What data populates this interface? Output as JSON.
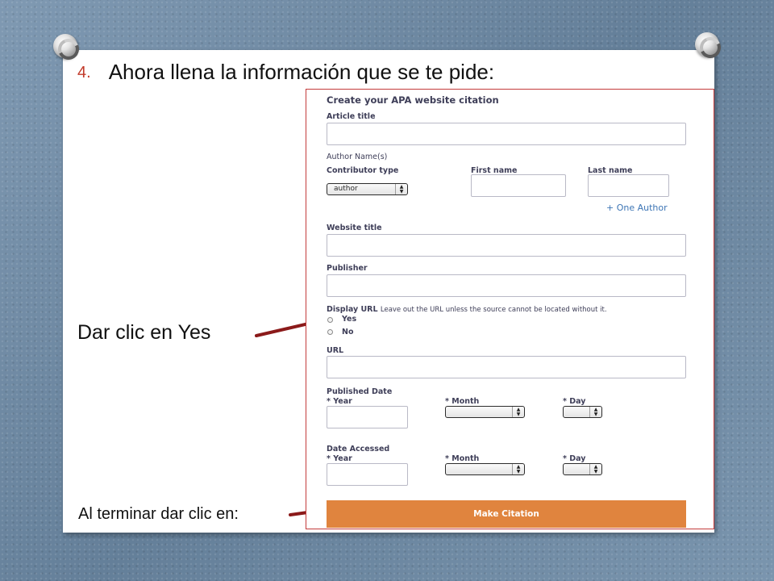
{
  "slide": {
    "step_number": "4.",
    "heading": "Ahora llena la información que se te pide:",
    "callout_yes": "Dar clic en Yes",
    "callout_finish": "Al terminar dar clic en:"
  },
  "form": {
    "title": "Create your APA website citation",
    "article_title_label": "Article title",
    "author_names_label": "Author Name(s)",
    "contributor_type_label": "Contributor type",
    "contributor_type_value": "author",
    "first_name_label": "First name",
    "last_name_label": "Last name",
    "add_author_link": "+ One Author",
    "website_title_label": "Website title",
    "publisher_label": "Publisher",
    "display_url_label": "Display URL",
    "display_url_note": "Leave out the URL unless the source cannot be located without it.",
    "yes_option": "Yes",
    "no_option": "No",
    "url_label": "URL",
    "published_date_label": "Published Date",
    "date_accessed_label": "Date Accessed",
    "year_label": "* Year",
    "month_label": "* Month",
    "day_label": "* Day",
    "make_citation_button": "Make Citation"
  },
  "colors": {
    "background": "#6f8aa4",
    "step_number": "#c23a2a",
    "arrow": "#8b1a1a",
    "button": "#e0843e",
    "link": "#3d75b5",
    "form_border": "#c33b3b"
  }
}
